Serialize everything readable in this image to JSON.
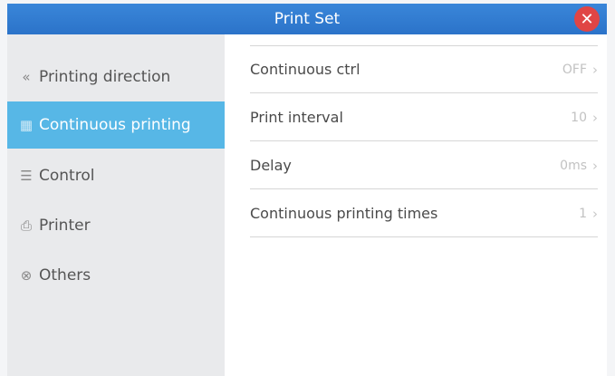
{
  "window": {
    "title": "Print Set",
    "close_label": "✕"
  },
  "sidebar": {
    "items": [
      {
        "label": "Printing direction",
        "icon": "double-chevron-left-icon",
        "glyph": "«",
        "active": false
      },
      {
        "label": "Continuous printing",
        "icon": "grid-icon",
        "glyph": "▦",
        "active": true
      },
      {
        "label": "Control",
        "icon": "sliders-icon",
        "glyph": "☰",
        "active": false
      },
      {
        "label": "Printer",
        "icon": "printer-icon",
        "glyph": "⎙",
        "active": false
      },
      {
        "label": "Others",
        "icon": "circle-x-icon",
        "glyph": "⊗",
        "active": false
      }
    ]
  },
  "settings": {
    "rows": [
      {
        "label": "Continuous ctrl",
        "value": "OFF"
      },
      {
        "label": "Print interval",
        "value": "10"
      },
      {
        "label": "Delay",
        "value": "0ms"
      },
      {
        "label": "Continuous printing times",
        "value": "1"
      }
    ]
  },
  "colors": {
    "titlebar": "#2b73c9",
    "active_item": "#57b7e6",
    "close_button": "#e04545"
  }
}
